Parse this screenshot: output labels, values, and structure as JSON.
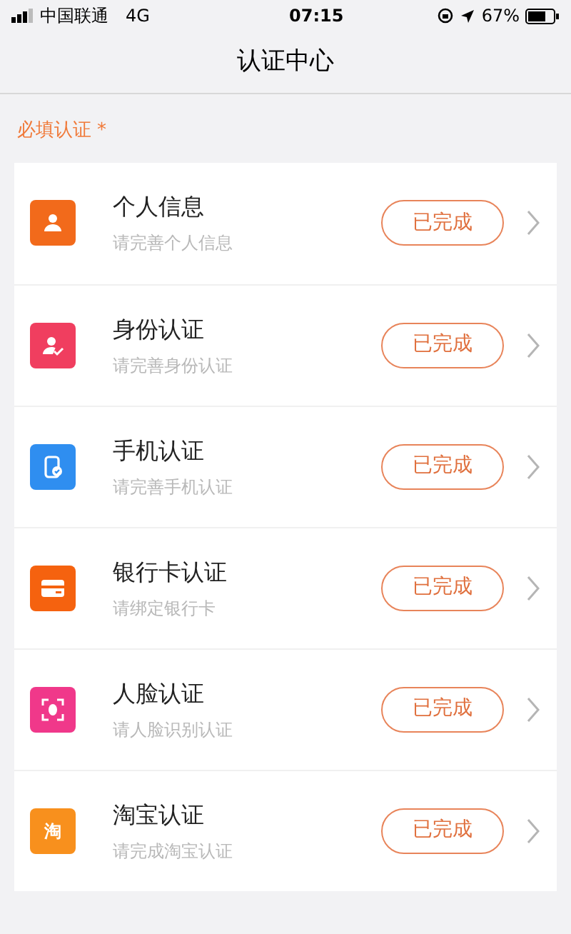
{
  "status_bar": {
    "carrier": "中国联通",
    "network": "4G",
    "time": "07:15",
    "battery": "67%"
  },
  "header": {
    "title": "认证中心"
  },
  "section": {
    "label": "必填认证",
    "required_mark": "*"
  },
  "items": [
    {
      "kind": "person",
      "color": "#f26a1b",
      "title": "个人信息",
      "subtitle": "请完善个人信息",
      "status": "已完成"
    },
    {
      "kind": "id",
      "color": "#f03e5f",
      "title": "身份认证",
      "subtitle": "请完善身份认证",
      "status": "已完成"
    },
    {
      "kind": "phone",
      "color": "#2f8ef0",
      "title": "手机认证",
      "subtitle": "请完善手机认证",
      "status": "已完成"
    },
    {
      "kind": "card",
      "color": "#f5620f",
      "title": "银行卡认证",
      "subtitle": "请绑定银行卡",
      "status": "已完成"
    },
    {
      "kind": "face",
      "color": "#f0388a",
      "title": "人脸认证",
      "subtitle": "请人脸识别认证",
      "status": "已完成"
    },
    {
      "kind": "glyph",
      "color": "#f8901d",
      "icon_text": "淘",
      "title": "淘宝认证",
      "subtitle": "请完成淘宝认证",
      "status": "已完成"
    }
  ]
}
